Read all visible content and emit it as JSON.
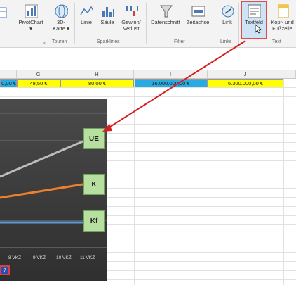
{
  "ribbon": {
    "pivotchart": {
      "line1": "PivotChart",
      "line2": "▾"
    },
    "karte3d": {
      "line1": "3D-",
      "line2": "Karte ▾"
    },
    "linie": "Linie",
    "saeule": "Säule",
    "gewinn": {
      "line1": "Gewinn/",
      "line2": "Verlust"
    },
    "datenschnitt": "Datenschnitt",
    "zeitachse": "Zeitachse",
    "link": "Link",
    "textfeld": "Textfeld",
    "kopf": {
      "line1": "Kopf- und",
      "line2": "Fußzeile"
    },
    "groups": {
      "touren": "Touren",
      "sparklines": "Sparklines",
      "filter": "Filter",
      "links": "Links",
      "text": "Text"
    }
  },
  "columns": [
    "G",
    "H",
    "I",
    "J"
  ],
  "cells": {
    "f": "0,00 €",
    "g": "48,50 €",
    "h": "80,00 €",
    "i": "16.000.000,00 €",
    "j": "6.300.000,00 €"
  },
  "chart_data": {
    "type": "line",
    "categories": [
      "8 VKZ",
      "9 VKZ",
      "10 VKZ",
      "11 VKZ"
    ],
    "series": [
      {
        "name": "UE",
        "color": "#bdbdbd"
      },
      {
        "name": "K",
        "color": "#f07f2a"
      },
      {
        "name": "Kf",
        "color": "#5b9bd5"
      }
    ]
  },
  "chart_labels": {
    "ue": "UE",
    "k": "K",
    "kf": "Kf"
  },
  "badge": "7",
  "colors": {
    "yellow": "#ffff00",
    "blue": "#29abe2",
    "arrow": "#d62020"
  }
}
